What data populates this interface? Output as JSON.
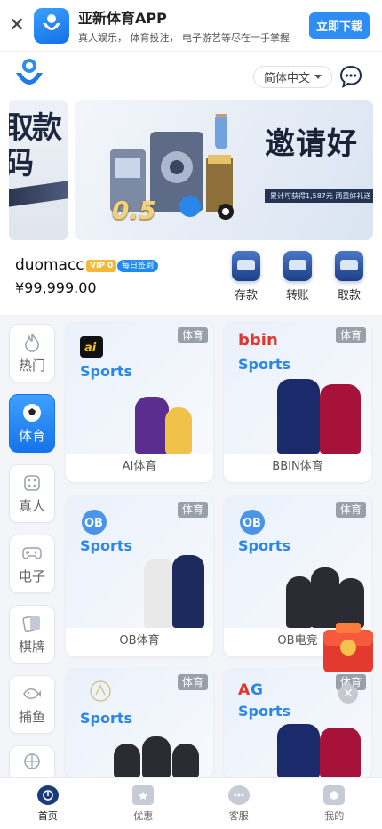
{
  "app_banner": {
    "title": "亚新体育APP",
    "subtitle": "真人娱乐， 体育投注， 电子游艺等尽在一手掌握",
    "download_label": "立即下载",
    "close_icon": "close-icon"
  },
  "header": {
    "language": "简体中文",
    "chat_icon": "chat-bubble-icon"
  },
  "carousel": {
    "left_slide_text": "取款\n码",
    "main_headline": "邀请好",
    "main_strip": "累计可获得1,587元  两重好礼送",
    "main_number": "0.5"
  },
  "user": {
    "username": "duomacc",
    "vip": "VIP 0",
    "daily_signin": "每日签到",
    "balance": "¥99,999.00"
  },
  "quick_actions": [
    {
      "label": "存款",
      "icon": "wallet-deposit-icon"
    },
    {
      "label": "转账",
      "icon": "transfer-icon"
    },
    {
      "label": "取款",
      "icon": "withdraw-icon"
    }
  ],
  "categories": [
    {
      "label": "热门",
      "icon": "flame-icon",
      "active": false
    },
    {
      "label": "体育",
      "icon": "soccer-ball-icon",
      "active": true
    },
    {
      "label": "真人",
      "icon": "dice-icon",
      "active": false
    },
    {
      "label": "电子",
      "icon": "gamepad-icon",
      "active": false
    },
    {
      "label": "棋牌",
      "icon": "cards-icon",
      "active": false
    },
    {
      "label": "捕鱼",
      "icon": "fish-icon",
      "active": false
    },
    {
      "label": "",
      "icon": "ferris-wheel-icon",
      "active": false
    }
  ],
  "games": [
    {
      "name": "AI体育",
      "tag": "体育",
      "brand": "ai",
      "sports_word": "Sports"
    },
    {
      "name": "BBIN体育",
      "tag": "体育",
      "brand": "bbin",
      "sports_word": "Sports"
    },
    {
      "name": "OB体育",
      "tag": "体育",
      "brand": "OB",
      "sports_word": "Sports"
    },
    {
      "name": "OB电竞",
      "tag": "体育",
      "brand": "OB",
      "sports_word": "Sports"
    },
    {
      "name": "",
      "tag": "体育",
      "brand": "",
      "sports_word": "Sports"
    },
    {
      "name": "",
      "tag": "体育",
      "brand": "AG",
      "sports_word": "Sports"
    }
  ],
  "bottom_nav": [
    {
      "label": "首页",
      "icon": "home-icon",
      "active": true
    },
    {
      "label": "优惠",
      "icon": "ticket-icon",
      "active": false
    },
    {
      "label": "客服",
      "icon": "support-icon",
      "active": false
    },
    {
      "label": "我的",
      "icon": "profile-icon",
      "active": false
    }
  ],
  "colors": {
    "primary": "#2e8df5",
    "active_category": "#1673ea",
    "sports_text": "#2a86e8",
    "tag_gray": "#9aa0aa"
  }
}
